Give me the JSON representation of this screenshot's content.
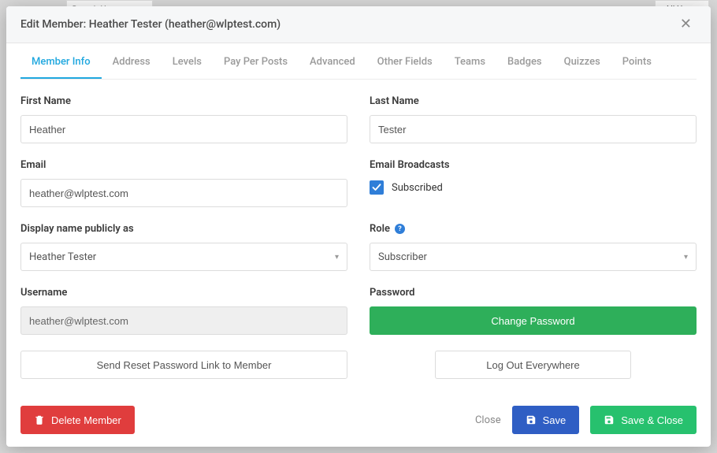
{
  "bg": {
    "search_placeholder": "Search Users",
    "all_users": "- All Users -"
  },
  "modal": {
    "title": "Edit Member: Heather Tester (heather@wlptest.com)"
  },
  "tabs": [
    "Member Info",
    "Address",
    "Levels",
    "Pay Per Posts",
    "Advanced",
    "Other Fields",
    "Teams",
    "Badges",
    "Quizzes",
    "Points"
  ],
  "labels": {
    "first_name": "First Name",
    "last_name": "Last Name",
    "email": "Email",
    "email_broadcasts": "Email Broadcasts",
    "subscribed": "Subscribed",
    "display_name": "Display name publicly as",
    "role": "Role",
    "username": "Username",
    "password": "Password"
  },
  "values": {
    "first_name": "Heather",
    "last_name": "Tester",
    "email": "heather@wlptest.com",
    "display_name_selected": "Heather Tester",
    "role_selected": "Subscriber",
    "username": "heather@wlptest.com"
  },
  "buttons": {
    "change_password": "Change Password",
    "send_reset": "Send Reset Password Link to Member",
    "log_out": "Log Out Everywhere",
    "delete": "Delete Member",
    "close": "Close",
    "save": "Save",
    "save_close": "Save & Close"
  }
}
